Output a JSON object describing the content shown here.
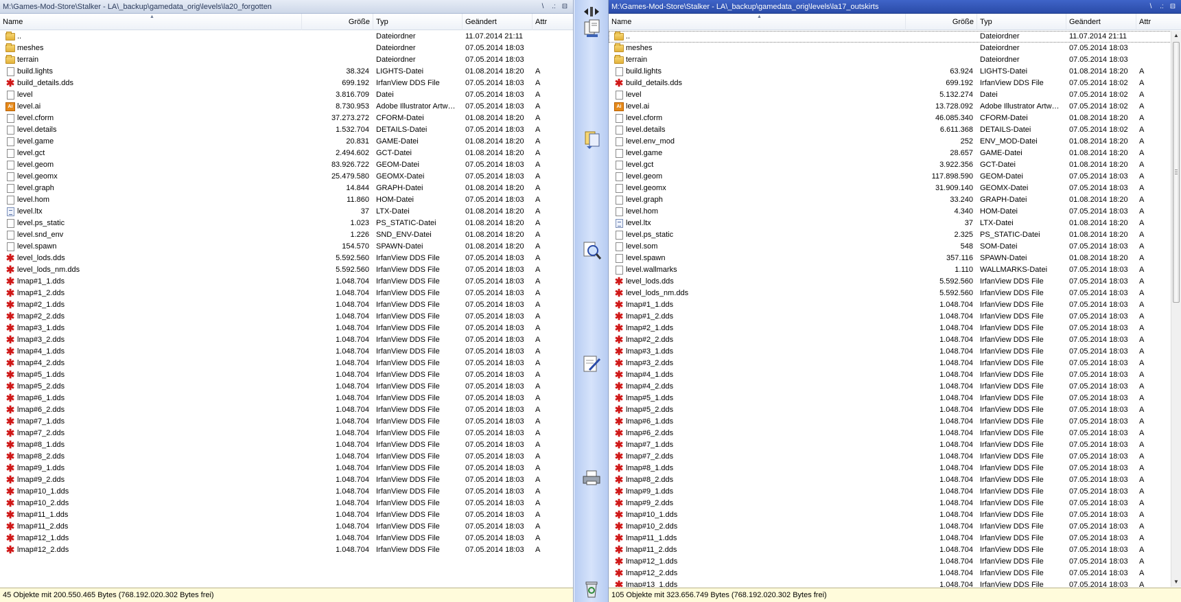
{
  "left": {
    "path": "M:\\Games-Mod-Store\\Stalker - LA\\_backup\\gamedata_orig\\levels\\la20_forgotten",
    "columns": {
      "name": "Name",
      "size": "Größe",
      "type": "Typ",
      "changed": "Geändert",
      "attr": "Attr"
    },
    "status": "45 Objekte mit 200.550.465 Bytes  (768.192.020.302 Bytes frei)",
    "rows": [
      {
        "name": "..",
        "size": "",
        "type": "Dateiordner",
        "date": "11.07.2014  21:11",
        "attr": "",
        "icon": "folder"
      },
      {
        "name": "meshes",
        "size": "",
        "type": "Dateiordner",
        "date": "07.05.2014  18:03",
        "attr": "",
        "icon": "folder"
      },
      {
        "name": "terrain",
        "size": "",
        "type": "Dateiordner",
        "date": "07.05.2014  18:03",
        "attr": "",
        "icon": "folder"
      },
      {
        "name": "build.lights",
        "size": "38.324",
        "type": "LIGHTS-Datei",
        "date": "01.08.2014  18:20",
        "attr": "A",
        "icon": "file"
      },
      {
        "name": "build_details.dds",
        "size": "699.192",
        "type": "IrfanView DDS File",
        "date": "07.05.2014  18:03",
        "attr": "A",
        "icon": "dds"
      },
      {
        "name": "level",
        "size": "3.816.709",
        "type": "Datei",
        "date": "07.05.2014  18:03",
        "attr": "A",
        "icon": "file"
      },
      {
        "name": "level.ai",
        "size": "8.730.953",
        "type": "Adobe Illustrator Artw…",
        "date": "07.05.2014  18:03",
        "attr": "A",
        "icon": "ai"
      },
      {
        "name": "level.cform",
        "size": "37.273.272",
        "type": "CFORM-Datei",
        "date": "01.08.2014  18:20",
        "attr": "A",
        "icon": "file"
      },
      {
        "name": "level.details",
        "size": "1.532.704",
        "type": "DETAILS-Datei",
        "date": "07.05.2014  18:03",
        "attr": "A",
        "icon": "file"
      },
      {
        "name": "level.game",
        "size": "20.831",
        "type": "GAME-Datei",
        "date": "01.08.2014  18:20",
        "attr": "A",
        "icon": "file"
      },
      {
        "name": "level.gct",
        "size": "2.494.602",
        "type": "GCT-Datei",
        "date": "01.08.2014  18:20",
        "attr": "A",
        "icon": "file"
      },
      {
        "name": "level.geom",
        "size": "83.926.722",
        "type": "GEOM-Datei",
        "date": "07.05.2014  18:03",
        "attr": "A",
        "icon": "file"
      },
      {
        "name": "level.geomx",
        "size": "25.479.580",
        "type": "GEOMX-Datei",
        "date": "07.05.2014  18:03",
        "attr": "A",
        "icon": "file"
      },
      {
        "name": "level.graph",
        "size": "14.844",
        "type": "GRAPH-Datei",
        "date": "01.08.2014  18:20",
        "attr": "A",
        "icon": "file"
      },
      {
        "name": "level.hom",
        "size": "11.860",
        "type": "HOM-Datei",
        "date": "07.05.2014  18:03",
        "attr": "A",
        "icon": "file"
      },
      {
        "name": "level.ltx",
        "size": "37",
        "type": "LTX-Datei",
        "date": "01.08.2014  18:20",
        "attr": "A",
        "icon": "ltx"
      },
      {
        "name": "level.ps_static",
        "size": "1.023",
        "type": "PS_STATIC-Datei",
        "date": "01.08.2014  18:20",
        "attr": "A",
        "icon": "file"
      },
      {
        "name": "level.snd_env",
        "size": "1.226",
        "type": "SND_ENV-Datei",
        "date": "01.08.2014  18:20",
        "attr": "A",
        "icon": "file"
      },
      {
        "name": "level.spawn",
        "size": "154.570",
        "type": "SPAWN-Datei",
        "date": "01.08.2014  18:20",
        "attr": "A",
        "icon": "file"
      },
      {
        "name": "level_lods.dds",
        "size": "5.592.560",
        "type": "IrfanView DDS File",
        "date": "07.05.2014  18:03",
        "attr": "A",
        "icon": "dds"
      },
      {
        "name": "level_lods_nm.dds",
        "size": "5.592.560",
        "type": "IrfanView DDS File",
        "date": "07.05.2014  18:03",
        "attr": "A",
        "icon": "dds"
      },
      {
        "name": "lmap#1_1.dds",
        "size": "1.048.704",
        "type": "IrfanView DDS File",
        "date": "07.05.2014  18:03",
        "attr": "A",
        "icon": "dds"
      },
      {
        "name": "lmap#1_2.dds",
        "size": "1.048.704",
        "type": "IrfanView DDS File",
        "date": "07.05.2014  18:03",
        "attr": "A",
        "icon": "dds"
      },
      {
        "name": "lmap#2_1.dds",
        "size": "1.048.704",
        "type": "IrfanView DDS File",
        "date": "07.05.2014  18:03",
        "attr": "A",
        "icon": "dds"
      },
      {
        "name": "lmap#2_2.dds",
        "size": "1.048.704",
        "type": "IrfanView DDS File",
        "date": "07.05.2014  18:03",
        "attr": "A",
        "icon": "dds"
      },
      {
        "name": "lmap#3_1.dds",
        "size": "1.048.704",
        "type": "IrfanView DDS File",
        "date": "07.05.2014  18:03",
        "attr": "A",
        "icon": "dds"
      },
      {
        "name": "lmap#3_2.dds",
        "size": "1.048.704",
        "type": "IrfanView DDS File",
        "date": "07.05.2014  18:03",
        "attr": "A",
        "icon": "dds"
      },
      {
        "name": "lmap#4_1.dds",
        "size": "1.048.704",
        "type": "IrfanView DDS File",
        "date": "07.05.2014  18:03",
        "attr": "A",
        "icon": "dds"
      },
      {
        "name": "lmap#4_2.dds",
        "size": "1.048.704",
        "type": "IrfanView DDS File",
        "date": "07.05.2014  18:03",
        "attr": "A",
        "icon": "dds"
      },
      {
        "name": "lmap#5_1.dds",
        "size": "1.048.704",
        "type": "IrfanView DDS File",
        "date": "07.05.2014  18:03",
        "attr": "A",
        "icon": "dds"
      },
      {
        "name": "lmap#5_2.dds",
        "size": "1.048.704",
        "type": "IrfanView DDS File",
        "date": "07.05.2014  18:03",
        "attr": "A",
        "icon": "dds"
      },
      {
        "name": "lmap#6_1.dds",
        "size": "1.048.704",
        "type": "IrfanView DDS File",
        "date": "07.05.2014  18:03",
        "attr": "A",
        "icon": "dds"
      },
      {
        "name": "lmap#6_2.dds",
        "size": "1.048.704",
        "type": "IrfanView DDS File",
        "date": "07.05.2014  18:03",
        "attr": "A",
        "icon": "dds"
      },
      {
        "name": "lmap#7_1.dds",
        "size": "1.048.704",
        "type": "IrfanView DDS File",
        "date": "07.05.2014  18:03",
        "attr": "A",
        "icon": "dds"
      },
      {
        "name": "lmap#7_2.dds",
        "size": "1.048.704",
        "type": "IrfanView DDS File",
        "date": "07.05.2014  18:03",
        "attr": "A",
        "icon": "dds"
      },
      {
        "name": "lmap#8_1.dds",
        "size": "1.048.704",
        "type": "IrfanView DDS File",
        "date": "07.05.2014  18:03",
        "attr": "A",
        "icon": "dds"
      },
      {
        "name": "lmap#8_2.dds",
        "size": "1.048.704",
        "type": "IrfanView DDS File",
        "date": "07.05.2014  18:03",
        "attr": "A",
        "icon": "dds"
      },
      {
        "name": "lmap#9_1.dds",
        "size": "1.048.704",
        "type": "IrfanView DDS File",
        "date": "07.05.2014  18:03",
        "attr": "A",
        "icon": "dds"
      },
      {
        "name": "lmap#9_2.dds",
        "size": "1.048.704",
        "type": "IrfanView DDS File",
        "date": "07.05.2014  18:03",
        "attr": "A",
        "icon": "dds"
      },
      {
        "name": "lmap#10_1.dds",
        "size": "1.048.704",
        "type": "IrfanView DDS File",
        "date": "07.05.2014  18:03",
        "attr": "A",
        "icon": "dds"
      },
      {
        "name": "lmap#10_2.dds",
        "size": "1.048.704",
        "type": "IrfanView DDS File",
        "date": "07.05.2014  18:03",
        "attr": "A",
        "icon": "dds"
      },
      {
        "name": "lmap#11_1.dds",
        "size": "1.048.704",
        "type": "IrfanView DDS File",
        "date": "07.05.2014  18:03",
        "attr": "A",
        "icon": "dds"
      },
      {
        "name": "lmap#11_2.dds",
        "size": "1.048.704",
        "type": "IrfanView DDS File",
        "date": "07.05.2014  18:03",
        "attr": "A",
        "icon": "dds"
      },
      {
        "name": "lmap#12_1.dds",
        "size": "1.048.704",
        "type": "IrfanView DDS File",
        "date": "07.05.2014  18:03",
        "attr": "A",
        "icon": "dds"
      },
      {
        "name": "lmap#12_2.dds",
        "size": "1.048.704",
        "type": "IrfanView DDS File",
        "date": "07.05.2014  18:03",
        "attr": "A",
        "icon": "dds"
      }
    ]
  },
  "right": {
    "path": "M:\\Games-Mod-Store\\Stalker - LA\\_backup\\gamedata_orig\\levels\\la17_outskirts",
    "columns": {
      "name": "Name",
      "size": "Größe",
      "type": "Typ",
      "changed": "Geändert",
      "attr": "Attr"
    },
    "status": "105 Objekte mit 323.656.749 Bytes  (768.192.020.302 Bytes frei)",
    "rows": [
      {
        "name": "..",
        "size": "",
        "type": "Dateiordner",
        "date": "11.07.2014  21:11",
        "attr": "",
        "icon": "folder"
      },
      {
        "name": "meshes",
        "size": "",
        "type": "Dateiordner",
        "date": "07.05.2014  18:03",
        "attr": "",
        "icon": "folder"
      },
      {
        "name": "terrain",
        "size": "",
        "type": "Dateiordner",
        "date": "07.05.2014  18:03",
        "attr": "",
        "icon": "folder"
      },
      {
        "name": "build.lights",
        "size": "63.924",
        "type": "LIGHTS-Datei",
        "date": "01.08.2014  18:20",
        "attr": "A",
        "icon": "file"
      },
      {
        "name": "build_details.dds",
        "size": "699.192",
        "type": "IrfanView DDS File",
        "date": "07.05.2014  18:02",
        "attr": "A",
        "icon": "dds"
      },
      {
        "name": "level",
        "size": "5.132.274",
        "type": "Datei",
        "date": "07.05.2014  18:02",
        "attr": "A",
        "icon": "file"
      },
      {
        "name": "level.ai",
        "size": "13.728.092",
        "type": "Adobe Illustrator Artw…",
        "date": "07.05.2014  18:02",
        "attr": "A",
        "icon": "ai"
      },
      {
        "name": "level.cform",
        "size": "46.085.340",
        "type": "CFORM-Datei",
        "date": "01.08.2014  18:20",
        "attr": "A",
        "icon": "file"
      },
      {
        "name": "level.details",
        "size": "6.611.368",
        "type": "DETAILS-Datei",
        "date": "07.05.2014  18:02",
        "attr": "A",
        "icon": "file"
      },
      {
        "name": "level.env_mod",
        "size": "252",
        "type": "ENV_MOD-Datei",
        "date": "01.08.2014  18:20",
        "attr": "A",
        "icon": "file"
      },
      {
        "name": "level.game",
        "size": "28.657",
        "type": "GAME-Datei",
        "date": "01.08.2014  18:20",
        "attr": "A",
        "icon": "file"
      },
      {
        "name": "level.gct",
        "size": "3.922.356",
        "type": "GCT-Datei",
        "date": "01.08.2014  18:20",
        "attr": "A",
        "icon": "file"
      },
      {
        "name": "level.geom",
        "size": "117.898.590",
        "type": "GEOM-Datei",
        "date": "07.05.2014  18:03",
        "attr": "A",
        "icon": "file"
      },
      {
        "name": "level.geomx",
        "size": "31.909.140",
        "type": "GEOMX-Datei",
        "date": "07.05.2014  18:03",
        "attr": "A",
        "icon": "file"
      },
      {
        "name": "level.graph",
        "size": "33.240",
        "type": "GRAPH-Datei",
        "date": "01.08.2014  18:20",
        "attr": "A",
        "icon": "file"
      },
      {
        "name": "level.hom",
        "size": "4.340",
        "type": "HOM-Datei",
        "date": "07.05.2014  18:03",
        "attr": "A",
        "icon": "file"
      },
      {
        "name": "level.ltx",
        "size": "37",
        "type": "LTX-Datei",
        "date": "01.08.2014  18:20",
        "attr": "A",
        "icon": "ltx"
      },
      {
        "name": "level.ps_static",
        "size": "2.325",
        "type": "PS_STATIC-Datei",
        "date": "01.08.2014  18:20",
        "attr": "A",
        "icon": "file"
      },
      {
        "name": "level.som",
        "size": "548",
        "type": "SOM-Datei",
        "date": "07.05.2014  18:03",
        "attr": "A",
        "icon": "file"
      },
      {
        "name": "level.spawn",
        "size": "357.116",
        "type": "SPAWN-Datei",
        "date": "01.08.2014  18:20",
        "attr": "A",
        "icon": "file"
      },
      {
        "name": "level.wallmarks",
        "size": "1.110",
        "type": "WALLMARKS-Datei",
        "date": "07.05.2014  18:03",
        "attr": "A",
        "icon": "file"
      },
      {
        "name": "level_lods.dds",
        "size": "5.592.560",
        "type": "IrfanView DDS File",
        "date": "07.05.2014  18:03",
        "attr": "A",
        "icon": "dds"
      },
      {
        "name": "level_lods_nm.dds",
        "size": "5.592.560",
        "type": "IrfanView DDS File",
        "date": "07.05.2014  18:03",
        "attr": "A",
        "icon": "dds"
      },
      {
        "name": "lmap#1_1.dds",
        "size": "1.048.704",
        "type": "IrfanView DDS File",
        "date": "07.05.2014  18:03",
        "attr": "A",
        "icon": "dds"
      },
      {
        "name": "lmap#1_2.dds",
        "size": "1.048.704",
        "type": "IrfanView DDS File",
        "date": "07.05.2014  18:03",
        "attr": "A",
        "icon": "dds"
      },
      {
        "name": "lmap#2_1.dds",
        "size": "1.048.704",
        "type": "IrfanView DDS File",
        "date": "07.05.2014  18:03",
        "attr": "A",
        "icon": "dds"
      },
      {
        "name": "lmap#2_2.dds",
        "size": "1.048.704",
        "type": "IrfanView DDS File",
        "date": "07.05.2014  18:03",
        "attr": "A",
        "icon": "dds"
      },
      {
        "name": "lmap#3_1.dds",
        "size": "1.048.704",
        "type": "IrfanView DDS File",
        "date": "07.05.2014  18:03",
        "attr": "A",
        "icon": "dds"
      },
      {
        "name": "lmap#3_2.dds",
        "size": "1.048.704",
        "type": "IrfanView DDS File",
        "date": "07.05.2014  18:03",
        "attr": "A",
        "icon": "dds"
      },
      {
        "name": "lmap#4_1.dds",
        "size": "1.048.704",
        "type": "IrfanView DDS File",
        "date": "07.05.2014  18:03",
        "attr": "A",
        "icon": "dds"
      },
      {
        "name": "lmap#4_2.dds",
        "size": "1.048.704",
        "type": "IrfanView DDS File",
        "date": "07.05.2014  18:03",
        "attr": "A",
        "icon": "dds"
      },
      {
        "name": "lmap#5_1.dds",
        "size": "1.048.704",
        "type": "IrfanView DDS File",
        "date": "07.05.2014  18:03",
        "attr": "A",
        "icon": "dds"
      },
      {
        "name": "lmap#5_2.dds",
        "size": "1.048.704",
        "type": "IrfanView DDS File",
        "date": "07.05.2014  18:03",
        "attr": "A",
        "icon": "dds"
      },
      {
        "name": "lmap#6_1.dds",
        "size": "1.048.704",
        "type": "IrfanView DDS File",
        "date": "07.05.2014  18:03",
        "attr": "A",
        "icon": "dds"
      },
      {
        "name": "lmap#6_2.dds",
        "size": "1.048.704",
        "type": "IrfanView DDS File",
        "date": "07.05.2014  18:03",
        "attr": "A",
        "icon": "dds"
      },
      {
        "name": "lmap#7_1.dds",
        "size": "1.048.704",
        "type": "IrfanView DDS File",
        "date": "07.05.2014  18:03",
        "attr": "A",
        "icon": "dds"
      },
      {
        "name": "lmap#7_2.dds",
        "size": "1.048.704",
        "type": "IrfanView DDS File",
        "date": "07.05.2014  18:03",
        "attr": "A",
        "icon": "dds"
      },
      {
        "name": "lmap#8_1.dds",
        "size": "1.048.704",
        "type": "IrfanView DDS File",
        "date": "07.05.2014  18:03",
        "attr": "A",
        "icon": "dds"
      },
      {
        "name": "lmap#8_2.dds",
        "size": "1.048.704",
        "type": "IrfanView DDS File",
        "date": "07.05.2014  18:03",
        "attr": "A",
        "icon": "dds"
      },
      {
        "name": "lmap#9_1.dds",
        "size": "1.048.704",
        "type": "IrfanView DDS File",
        "date": "07.05.2014  18:03",
        "attr": "A",
        "icon": "dds"
      },
      {
        "name": "lmap#9_2.dds",
        "size": "1.048.704",
        "type": "IrfanView DDS File",
        "date": "07.05.2014  18:03",
        "attr": "A",
        "icon": "dds"
      },
      {
        "name": "lmap#10_1.dds",
        "size": "1.048.704",
        "type": "IrfanView DDS File",
        "date": "07.05.2014  18:03",
        "attr": "A",
        "icon": "dds"
      },
      {
        "name": "lmap#10_2.dds",
        "size": "1.048.704",
        "type": "IrfanView DDS File",
        "date": "07.05.2014  18:03",
        "attr": "A",
        "icon": "dds"
      },
      {
        "name": "lmap#11_1.dds",
        "size": "1.048.704",
        "type": "IrfanView DDS File",
        "date": "07.05.2014  18:03",
        "attr": "A",
        "icon": "dds"
      },
      {
        "name": "lmap#11_2.dds",
        "size": "1.048.704",
        "type": "IrfanView DDS File",
        "date": "07.05.2014  18:03",
        "attr": "A",
        "icon": "dds"
      },
      {
        "name": "lmap#12_1.dds",
        "size": "1.048.704",
        "type": "IrfanView DDS File",
        "date": "07.05.2014  18:03",
        "attr": "A",
        "icon": "dds"
      },
      {
        "name": "lmap#12_2.dds",
        "size": "1.048.704",
        "type": "IrfanView DDS File",
        "date": "07.05.2014  18:03",
        "attr": "A",
        "icon": "dds"
      },
      {
        "name": "lmap#13_1.dds",
        "size": "1.048.704",
        "type": "IrfanView DDS File",
        "date": "07.05.2014  18:03",
        "attr": "A",
        "icon": "dds"
      }
    ]
  },
  "path_tools": [
    "\\",
    ".:",
    "⊟"
  ],
  "toolbar_buttons": [
    "swap-panels-icon",
    "copy-icon",
    "move-icon",
    "view-icon",
    "edit-icon",
    "print-icon",
    "recycle-bin-icon"
  ],
  "colors": {
    "active_path_bg": "#2a4ba8",
    "inactive_path_bg": "#cdd7e8",
    "status_bg": "#fffbdb",
    "toolbar_bg": "#c6d8f7",
    "dds_icon": "#d01818"
  }
}
